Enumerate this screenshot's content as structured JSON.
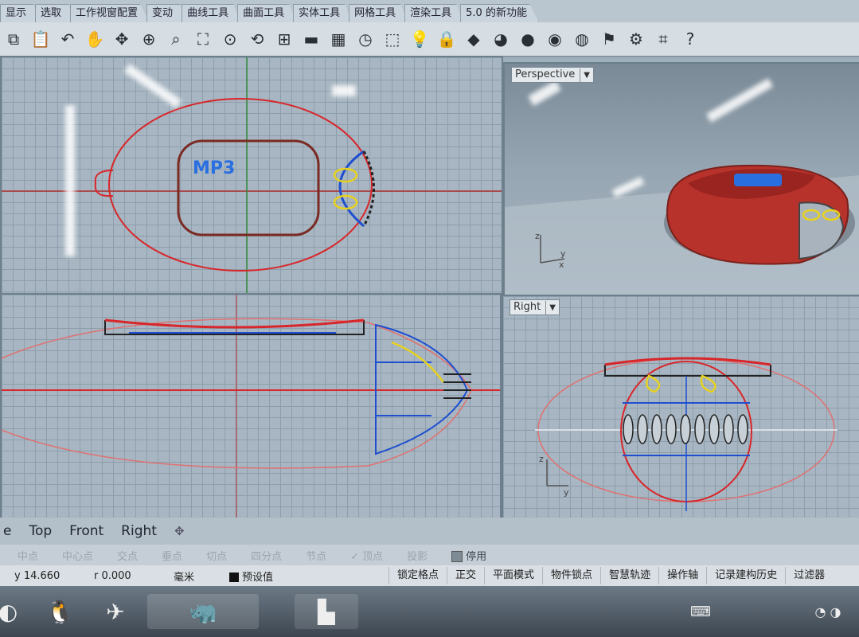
{
  "menu_tabs": [
    "显示",
    "选取",
    "工作视窗配置",
    "变动",
    "曲线工具",
    "曲面工具",
    "实体工具",
    "网格工具",
    "渲染工具",
    "5.0 的新功能"
  ],
  "toolbar_icons": [
    {
      "name": "copy-icon",
      "glyph": "⧉"
    },
    {
      "name": "paste-icon",
      "glyph": "📋"
    },
    {
      "name": "undo-icon",
      "glyph": "↶"
    },
    {
      "name": "pan-hand-icon",
      "glyph": "✋"
    },
    {
      "name": "rotate-view-icon",
      "glyph": "✥"
    },
    {
      "name": "zoom-icon",
      "glyph": "⊕"
    },
    {
      "name": "zoom-window-icon",
      "glyph": "⌕"
    },
    {
      "name": "zoom-extents-icon",
      "glyph": "⛶"
    },
    {
      "name": "zoom-selected-icon",
      "glyph": "⊙"
    },
    {
      "name": "undo-view-icon",
      "glyph": "⟲"
    },
    {
      "name": "four-viewports-icon",
      "glyph": "⊞"
    },
    {
      "name": "car-icon",
      "glyph": "▬"
    },
    {
      "name": "layers-icon",
      "glyph": "▦"
    },
    {
      "name": "clock-icon",
      "glyph": "◷"
    },
    {
      "name": "select-icon",
      "glyph": "⬚"
    },
    {
      "name": "lightbulb-icon",
      "glyph": "💡"
    },
    {
      "name": "lock-icon",
      "glyph": "🔒"
    },
    {
      "name": "material-icon",
      "glyph": "◆"
    },
    {
      "name": "color-wheel-icon",
      "glyph": "◕"
    },
    {
      "name": "shaded-sphere-icon",
      "glyph": "●"
    },
    {
      "name": "rendered-sphere-icon",
      "glyph": "◉"
    },
    {
      "name": "render-icon",
      "glyph": "◍"
    },
    {
      "name": "flag-icon",
      "glyph": "⚑"
    },
    {
      "name": "gear-icon",
      "glyph": "⚙"
    },
    {
      "name": "tools-icon",
      "glyph": "⌗"
    },
    {
      "name": "help-icon",
      "glyph": "?"
    }
  ],
  "viewports": {
    "top": {
      "text_on_model": "MP3"
    },
    "perspective": {
      "label": "Perspective",
      "axis_z": "z",
      "axis_y": "y",
      "axis_x": "x"
    },
    "front": {},
    "right": {
      "label": "Right",
      "axis_z": "z",
      "axis_y": "y"
    }
  },
  "view_tabs": {
    "partial": "e",
    "top": "Top",
    "front": "Front",
    "right": "Right",
    "add": "✥"
  },
  "osnaps": [
    {
      "label": "中点",
      "on": false
    },
    {
      "label": "中心点",
      "on": false
    },
    {
      "label": "交点",
      "on": false
    },
    {
      "label": "垂点",
      "on": false
    },
    {
      "label": "切点",
      "on": false
    },
    {
      "label": "四分点",
      "on": false
    },
    {
      "label": "节点",
      "on": false
    },
    {
      "label": "✓ 顶点",
      "on": false
    },
    {
      "label": "投影",
      "on": false
    }
  ],
  "osnap_disable": "停用",
  "status": {
    "y": "y 14.660",
    "r": "r 0.000",
    "units": "毫米",
    "layer": "预设值",
    "toggles": [
      "锁定格点",
      "正交",
      "平面模式",
      "物件锁点",
      "智慧轨迹",
      "操作轴",
      "记录建构历史",
      "过滤器"
    ]
  },
  "colors": {
    "curve_red": "#d8262a",
    "curve_blue": "#1f4fd0",
    "curve_yellow": "#e8d21e",
    "model_red": "#b8322c",
    "screen_blue": "#2a6fe0"
  }
}
